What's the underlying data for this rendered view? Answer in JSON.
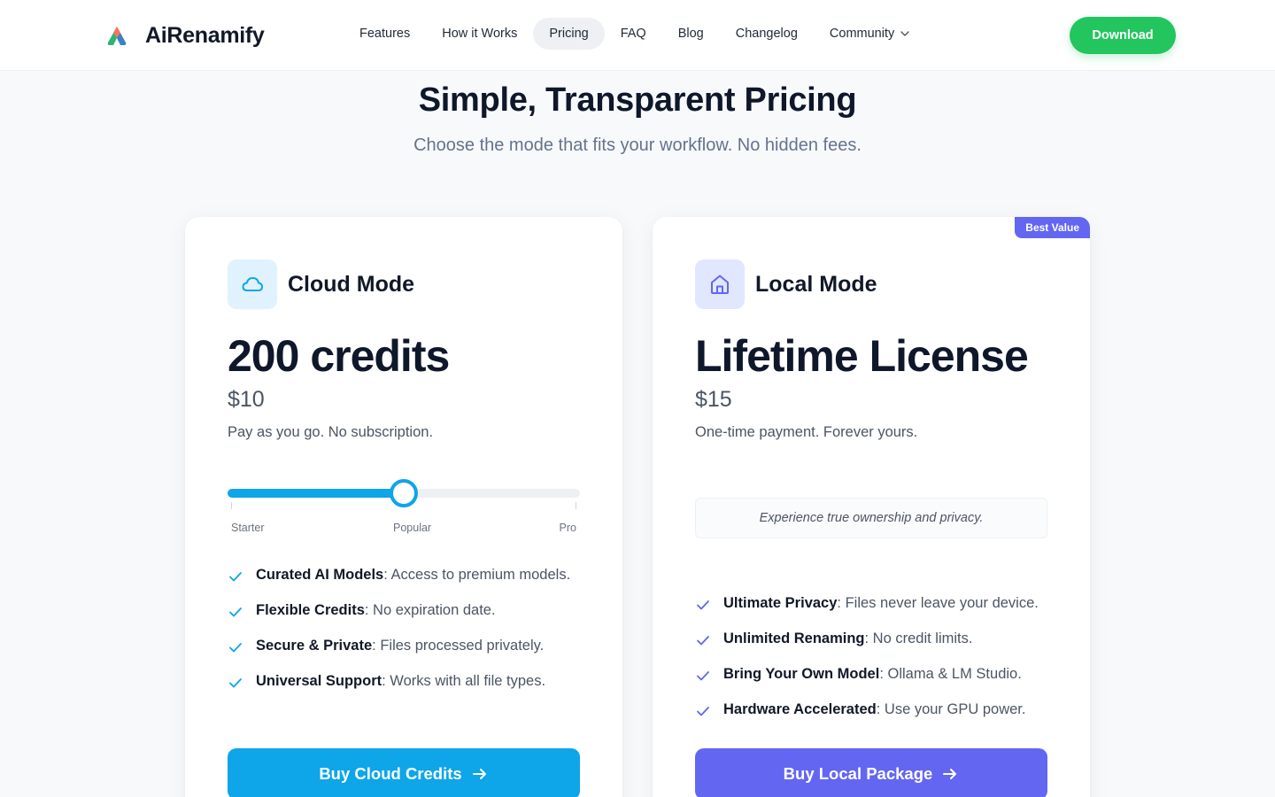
{
  "header": {
    "brand": "AiRenamify",
    "nav": [
      {
        "label": "Features"
      },
      {
        "label": "How it Works"
      },
      {
        "label": "Pricing",
        "active": true
      },
      {
        "label": "FAQ"
      },
      {
        "label": "Blog"
      },
      {
        "label": "Changelog"
      },
      {
        "label": "Community",
        "dropdown": true
      }
    ],
    "download_label": "Download"
  },
  "hero": {
    "title": "Simple, Transparent Pricing",
    "subtitle": "Choose the mode that fits your workflow. No hidden fees."
  },
  "cloud": {
    "mode_title": "Cloud Mode",
    "big_title": "200 credits",
    "price": "$10",
    "desc": "Pay as you go. No subscription.",
    "slider": {
      "value_fraction": 0.5,
      "labels": [
        "Starter",
        "Popular",
        "Pro"
      ]
    },
    "features": [
      {
        "title": "Curated AI Models",
        "text": ": Access to premium models."
      },
      {
        "title": "Flexible Credits",
        "text": ": No expiration date."
      },
      {
        "title": "Secure & Private",
        "text": ": Files processed privately."
      },
      {
        "title": "Universal Support",
        "text": ": Works with all file types."
      }
    ],
    "button": "Buy Cloud Credits",
    "accent": "#0ea5e9"
  },
  "local": {
    "badge": "Best Value",
    "mode_title": "Local Mode",
    "big_title": "Lifetime License",
    "price": "$15",
    "desc": "One-time payment. Forever yours.",
    "note": "Experience true ownership and privacy.",
    "features": [
      {
        "title": "Ultimate Privacy",
        "text": ": Files never leave your device."
      },
      {
        "title": "Unlimited Renaming",
        "text": ": No credit limits."
      },
      {
        "title": "Bring Your Own Model",
        "text": ": Ollama & LM Studio."
      },
      {
        "title": "Hardware Accelerated",
        "text": ": Use your GPU power."
      }
    ],
    "button": "Buy Local Package",
    "accent": "#6366f1"
  },
  "icons": {
    "logo": "airenamify-logo",
    "cloud": "cloud-icon",
    "local": "house-icon",
    "check": "check-icon",
    "arrow": "arrow-right-icon",
    "dropdown": "chevron-down-icon"
  }
}
